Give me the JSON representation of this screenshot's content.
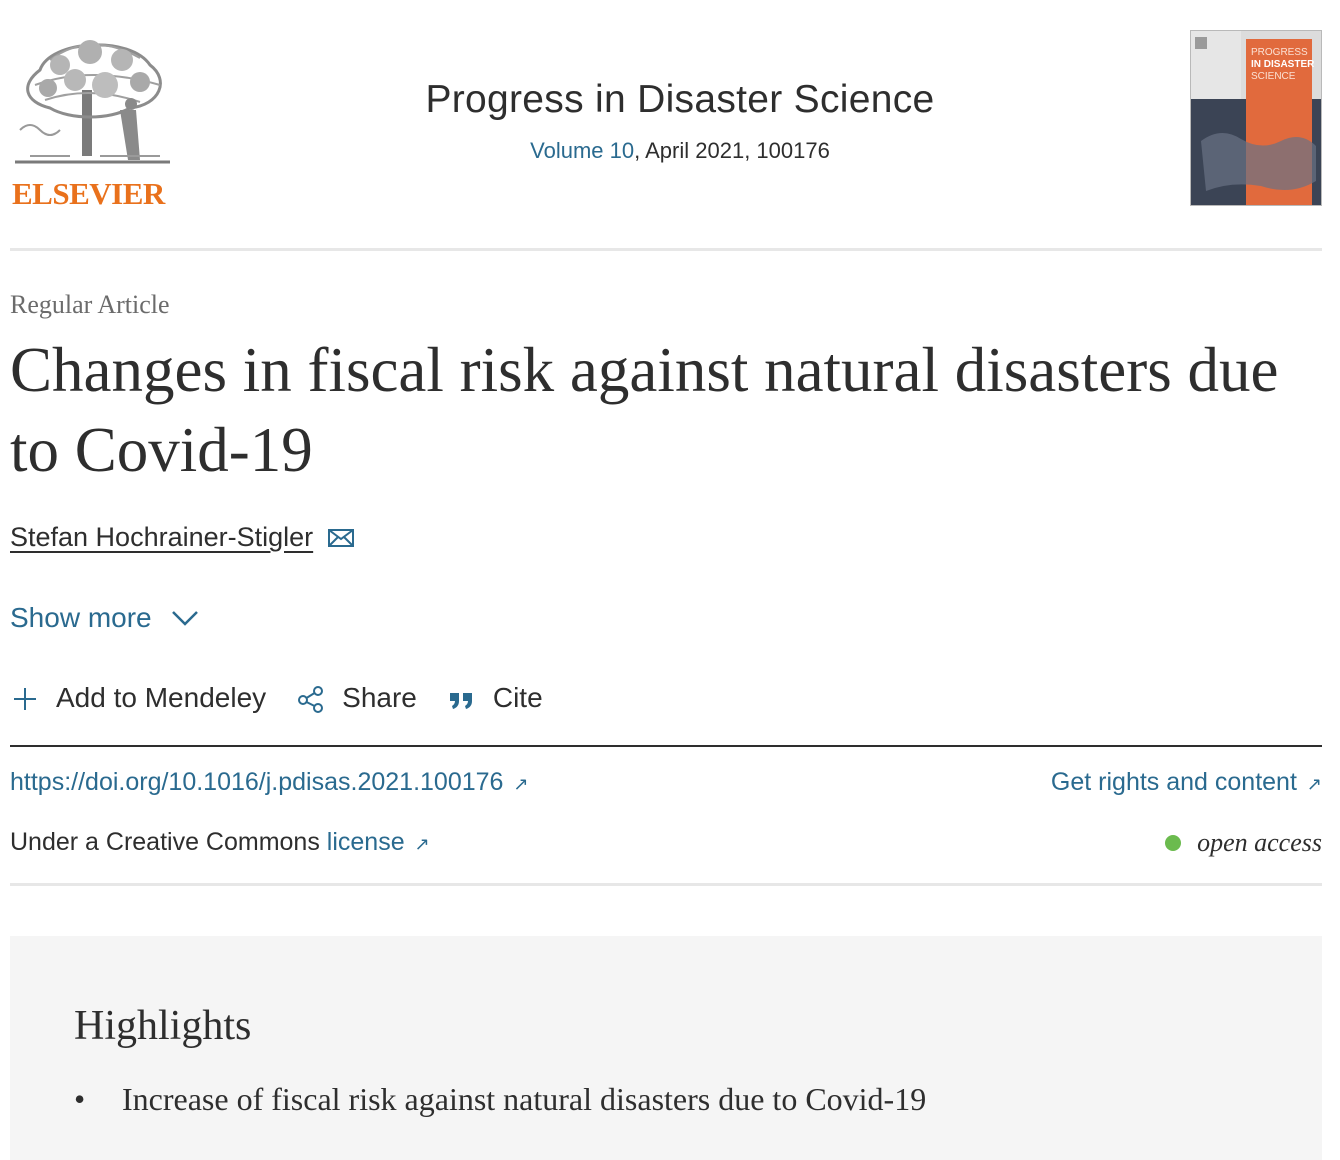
{
  "header": {
    "publisher": "ELSEVIER",
    "journal_title": "Progress in Disaster Science",
    "volume_link": "Volume 10",
    "issue_info": ", April 2021, 100176",
    "cover": {
      "line1": "PROGRESS",
      "line2": "IN DISASTER",
      "line3": "SCIENCE"
    }
  },
  "article": {
    "type": "Regular Article",
    "title": "Changes in fiscal risk against natural disasters due to Covid-19",
    "author": "Stefan Hochrainer-Stigler",
    "show_more": "Show more"
  },
  "actions": {
    "mendeley": "Add to Mendeley",
    "share": "Share",
    "cite": "Cite"
  },
  "links": {
    "doi": "https://doi.org/10.1016/j.pdisas.2021.100176",
    "rights": "Get rights and content",
    "license_prefix": "Under a Creative Commons ",
    "license_link": "license",
    "open_access": "open access",
    "external_icon": "↗"
  },
  "highlights": {
    "title": "Highlights",
    "items": [
      "Increase of fiscal risk against natural disasters due to Covid-19"
    ]
  },
  "colors": {
    "link": "#2a6a8f",
    "publisher_orange": "#e9711c",
    "open_access_dot": "#6bbb4e"
  }
}
